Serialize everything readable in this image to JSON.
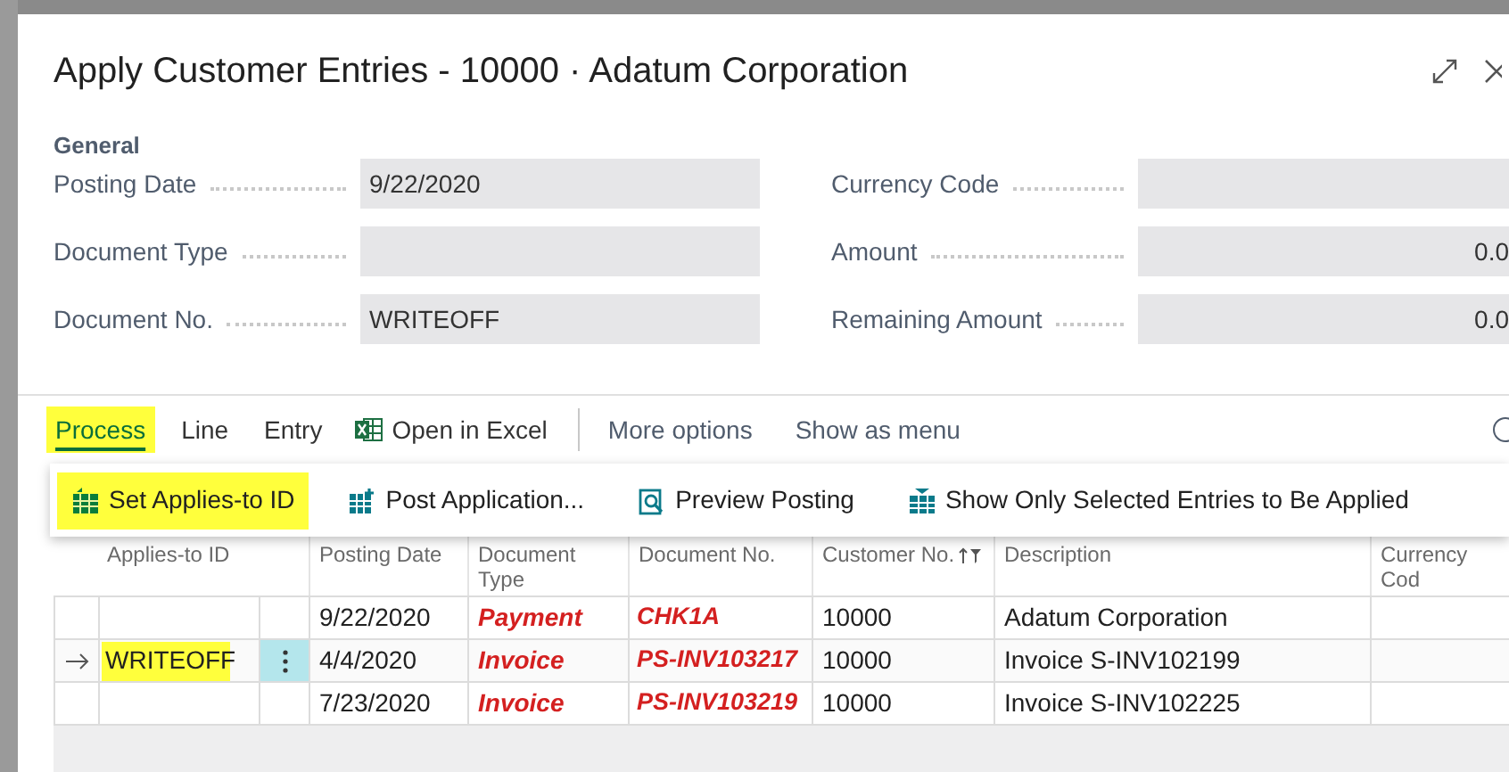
{
  "dialog": {
    "title": "Apply Customer Entries - 10000 · Adatum Corporation"
  },
  "general": {
    "heading": "General",
    "left_fields": [
      {
        "label": "Posting Date",
        "value": "9/22/2020"
      },
      {
        "label": "Document Type"
      },
      {
        "label": "Document No.",
        "value": "WRITEOFF"
      }
    ],
    "right_fields": [
      {
        "label": "Currency Code"
      },
      {
        "label": "Amount",
        "value": "0.0"
      },
      {
        "label": "Remaining Amount",
        "value": "0.0"
      }
    ]
  },
  "toolbar": {
    "tabs": [
      {
        "label": "Process",
        "selected": true,
        "highlighted": true
      },
      {
        "label": "Line",
        "selected": false,
        "highlighted": false
      },
      {
        "label": "Entry",
        "selected": false,
        "highlighted": false
      }
    ],
    "actions": [
      {
        "label": "Open in Excel",
        "kind": "excel"
      }
    ],
    "links": [
      "More options",
      "Show as menu"
    ]
  },
  "process_menu": [
    {
      "label": "Set Applies-to ID",
      "kind": "set",
      "highlighted": true
    },
    {
      "label": "Post Application...",
      "kind": "post",
      "highlighted": false
    },
    {
      "label": "Preview Posting",
      "kind": "preview",
      "highlighted": false
    },
    {
      "label": "Show Only Selected Entries to Be Applied",
      "kind": "show",
      "highlighted": false
    }
  ],
  "table": {
    "columns": [
      "Applies-to ID",
      "Posting Date",
      "Document Type",
      "Document No.",
      "Customer No.",
      "Description",
      "Currency Cod"
    ],
    "rows": [
      {
        "current": false,
        "applies_to_highlighted": false,
        "posting_date": "9/22/2020",
        "document_type": "Payment",
        "document_no": "CHK1A",
        "customer_no": "10000",
        "description": "Adatum Corporation"
      },
      {
        "current": true,
        "applies_to_id": "WRITEOFF",
        "applies_to_highlighted": true,
        "posting_date": "4/4/2020",
        "document_type": "Invoice",
        "document_no": "PS-INV103217",
        "customer_no": "10000",
        "description": "Invoice S-INV102199"
      },
      {
        "current": false,
        "applies_to_highlighted": false,
        "posting_date": "7/23/2020",
        "document_type": "Invoice",
        "document_no": "PS-INV103219",
        "customer_no": "10000",
        "description": "Invoice S-INV102225"
      }
    ]
  }
}
